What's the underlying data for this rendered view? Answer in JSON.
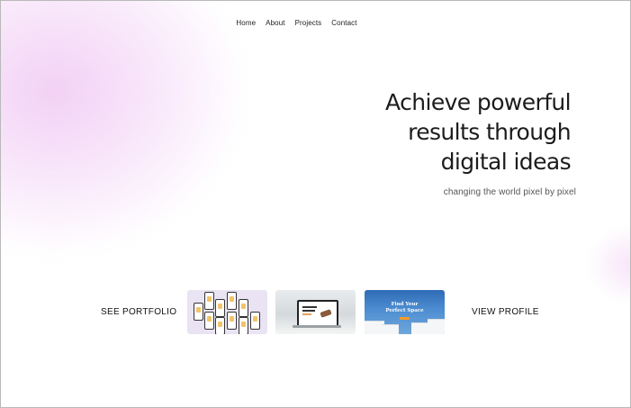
{
  "nav": {
    "items": [
      "Home",
      "About",
      "Projects",
      "Contact"
    ]
  },
  "hero": {
    "title_line1": "Achieve powerful",
    "title_line2": "results through",
    "title_line3": "digital ideas",
    "subtitle": "changing the world pixel by pixel"
  },
  "cta": {
    "portfolio": "SEE PORTFOLIO",
    "profile": "VIEW PROFILE"
  },
  "thumbnails": {
    "t3_caption_line1": "Find Your",
    "t3_caption_line2": "Perfect Space"
  },
  "colors": {
    "blob": "#e8aaec",
    "text": "#1c1c1c",
    "muted": "#555555"
  }
}
